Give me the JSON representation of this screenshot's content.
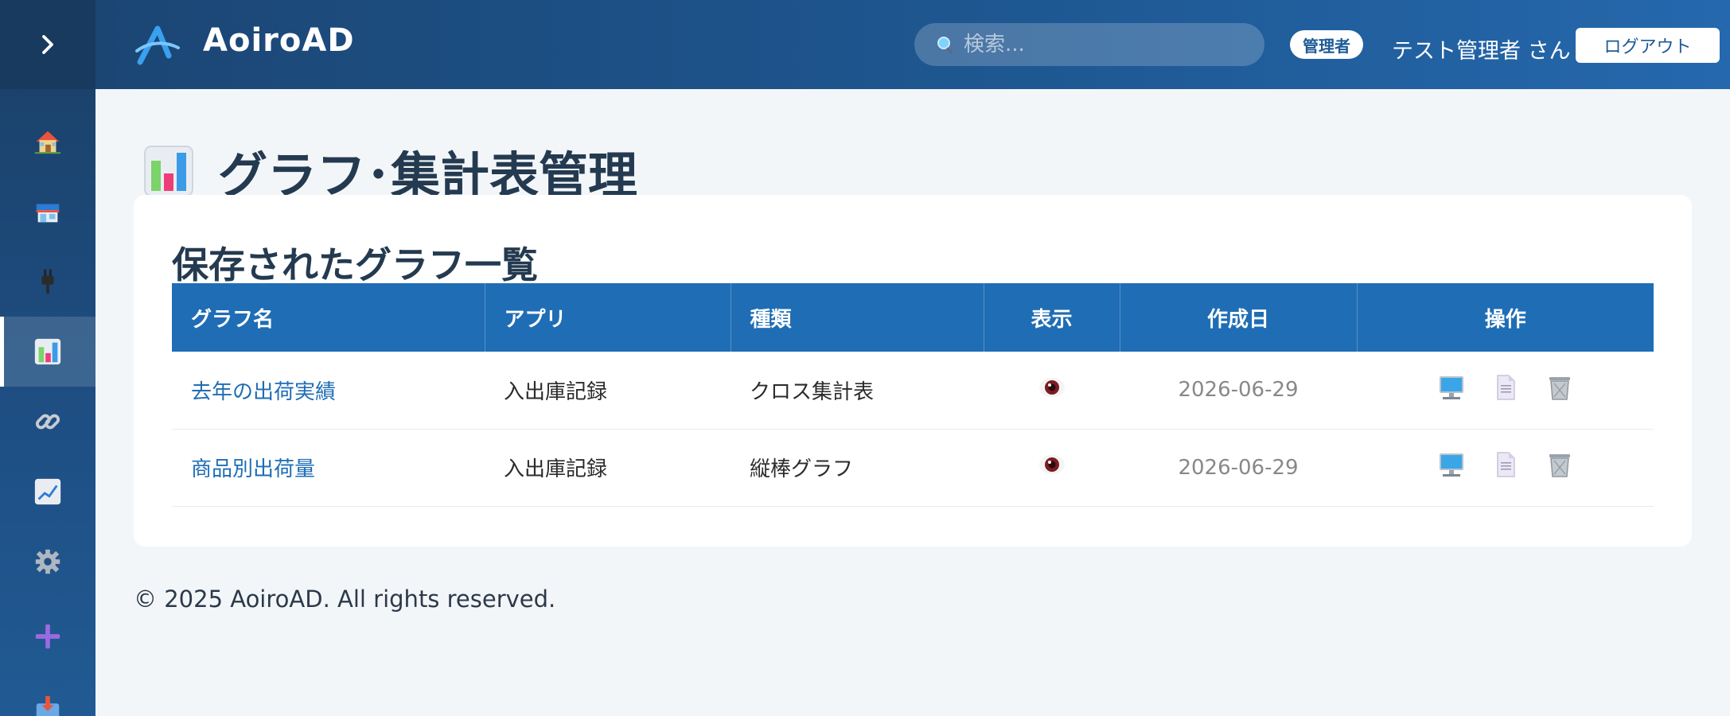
{
  "header": {
    "brand": "AoiroAD",
    "search_placeholder": "検索...",
    "role_badge": "管理者",
    "user_name": "テスト管理者 さん",
    "logout_label": "ログアウト"
  },
  "sidebar": {
    "items": [
      {
        "icon": "home-icon"
      },
      {
        "icon": "store-icon"
      },
      {
        "icon": "plug-icon"
      },
      {
        "icon": "bar-chart-icon",
        "active": true
      },
      {
        "icon": "link-icon"
      },
      {
        "icon": "line-chart-icon"
      },
      {
        "icon": "gear-icon"
      },
      {
        "icon": "plus-icon"
      },
      {
        "icon": "inbox-download-icon"
      }
    ]
  },
  "page": {
    "title": "グラフ･集計表管理"
  },
  "card": {
    "title": "保存されたグラフ一覧",
    "columns": [
      "グラフ名",
      "アプリ",
      "種類",
      "表示",
      "作成日",
      "操作"
    ],
    "rows": [
      {
        "name": "去年の出荷実績",
        "app": "入出庫記録",
        "type": "クロス集計表",
        "date": "2026-06-29"
      },
      {
        "name": "商品別出荷量",
        "app": "入出庫記録",
        "type": "縦棒グラフ",
        "date": "2026-06-29"
      }
    ]
  },
  "footer": {
    "text": "© 2025 AoiroAD. All rights reserved."
  },
  "colors": {
    "primary": "#1f6db5",
    "header_dark": "#1b4674",
    "sidebar_dark": "#193a5f",
    "background": "#f3f6f9",
    "title_text": "#243a50"
  }
}
